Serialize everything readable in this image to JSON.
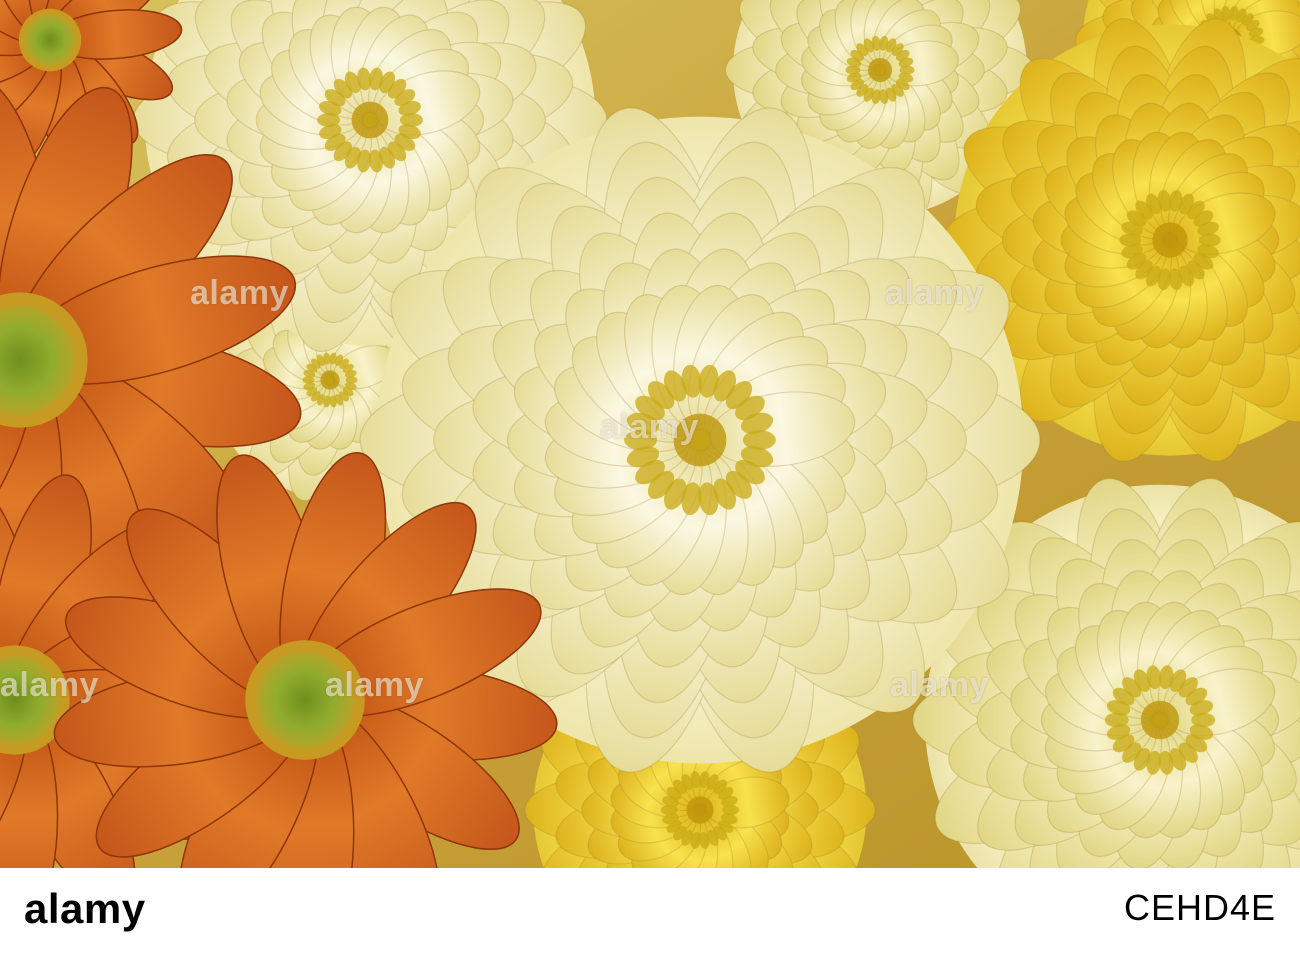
{
  "watermarks": [
    "alamy",
    "alamy",
    "alamy",
    "alamy",
    "alamy",
    "alamy"
  ],
  "footer": {
    "brand": "alamy",
    "image_id": "CEHD4E"
  },
  "palette": {
    "cream": "#f3eeb2",
    "pale_yellow": "#ece58a",
    "yellow": "#f2d62e",
    "deep_yellow": "#e2b51f",
    "orange": "#d4641c",
    "dark_orange": "#a8420f",
    "green_center": "#8cab2c"
  }
}
